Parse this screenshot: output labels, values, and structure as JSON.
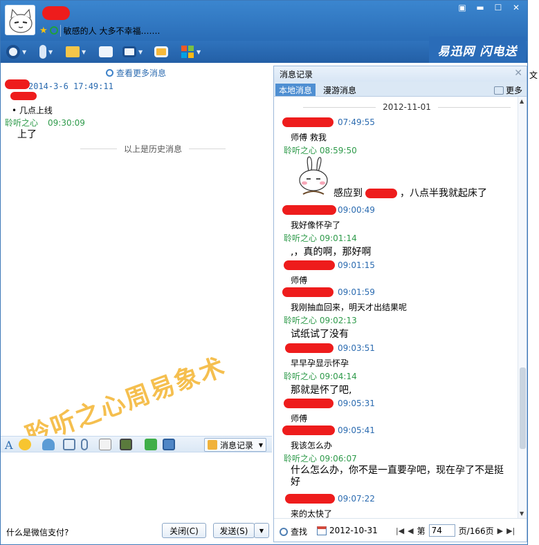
{
  "contact": {
    "signature": "敏感的人 大多不幸福……."
  },
  "window_controls": {
    "minimize_icon": "chevron-down-box-icon",
    "min": "▬",
    "max": "☐",
    "close": "✕",
    "menu": "▣"
  },
  "ad": {
    "text": "易迅网 闪电送"
  },
  "chat": {
    "see_more": "查看更多消息",
    "history": [
      {
        "time": "2014-3-6 17:49:11",
        "text": "几点上线"
      },
      {
        "sender": "聆听之心",
        "time": "09:30:09",
        "text": "上了"
      }
    ],
    "divider": "以上是历史消息",
    "watermark": "聆听之心周易象术"
  },
  "input_toolbar": {
    "message_record": "消息记录"
  },
  "bottom": {
    "faq": "什么是微信支付?",
    "close": "关闭(C)",
    "send": "发送(S)"
  },
  "side_text": "文",
  "history_panel": {
    "title": "消息记录",
    "tabs": [
      "本地消息",
      "漫游消息"
    ],
    "more": "更多",
    "date": "2012-11-01",
    "messages": [
      {
        "sender": "",
        "time": "07:49:55",
        "text": "师傅  救我"
      },
      {
        "sender": "聆听之心",
        "time": "08:59:50",
        "text": "感应到",
        "text_after": "，八点半我就起床了"
      },
      {
        "sender": "",
        "time": "09:00:49",
        "text": "我好像怀孕了"
      },
      {
        "sender": "聆听之心",
        "time": "09:01:14",
        "text": ",，真的啊，那好啊"
      },
      {
        "sender": "",
        "time": "09:01:15",
        "text": "师傅"
      },
      {
        "sender": "",
        "time": "09:01:59",
        "text": "我刚抽血回来，明天才出结果呢"
      },
      {
        "sender": "聆听之心",
        "time": "09:02:13",
        "text": "试纸试了没有"
      },
      {
        "sender": "",
        "time": "09:03:51",
        "text": "早早孕显示怀孕"
      },
      {
        "sender": "聆听之心",
        "time": "09:04:14",
        "text": "那就是怀了吧,"
      },
      {
        "sender": "",
        "time": "09:05:31",
        "text": "师傅"
      },
      {
        "sender": "",
        "time": "09:05:41",
        "text": "我该怎么办"
      },
      {
        "sender": "聆听之心",
        "time": "09:06:07",
        "text": "什么怎么办，你不是一直要孕吧，现在孕了不是挺好"
      },
      {
        "sender": "",
        "time": "09:07:22",
        "text": "来的太快了"
      }
    ],
    "footer": {
      "find": "查找",
      "date": "2012-10-31",
      "page_prefix": "第",
      "page": "74",
      "page_suffix": "页/166页"
    }
  }
}
